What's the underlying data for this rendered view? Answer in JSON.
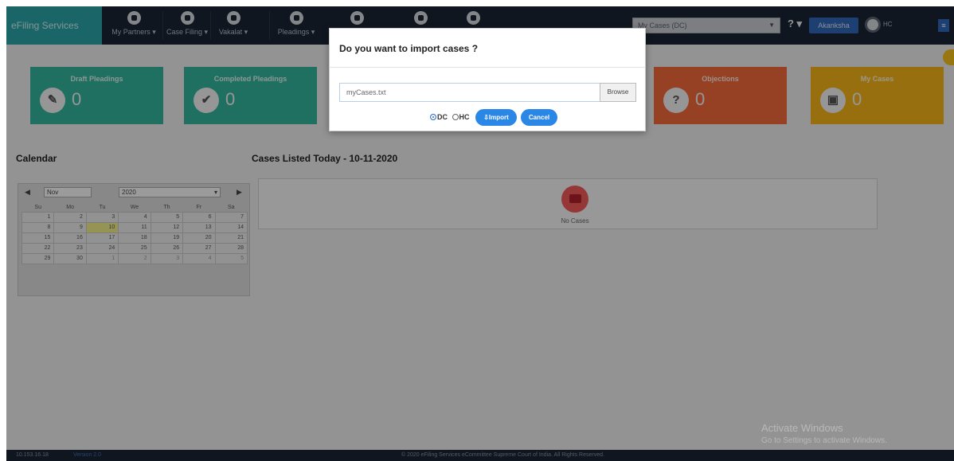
{
  "navbar": {
    "brand": "eFiling Services",
    "items": [
      {
        "label": "My Partners ▾"
      },
      {
        "label": "Case Filing ▾"
      },
      {
        "label": "Vakalat ▾"
      },
      {
        "label": "Pleadings ▾"
      },
      {
        "label": ""
      },
      {
        "label": ""
      },
      {
        "label": ""
      }
    ],
    "select_value": "My Cases (DC)",
    "help": "? ▾",
    "user_label": "Akanksha",
    "avatar_label": "HC",
    "right_btn": "≡"
  },
  "cards": {
    "draft": {
      "title": "Draft Pleadings",
      "count": "0",
      "icon": "edit-icon"
    },
    "completed": {
      "title": "Completed Pleadings",
      "count": "0",
      "icon": "check-icon"
    },
    "objections": {
      "title": "Objections",
      "count": "0",
      "icon": "question-icon"
    },
    "my_cases": {
      "title": "My Cases",
      "count": "0",
      "icon": "briefcase-icon"
    }
  },
  "calendar": {
    "title": "Calendar",
    "prev": "◀",
    "next": "▶",
    "month": "Nov",
    "year": "2020",
    "weekdays": [
      "Su",
      "Mo",
      "Tu",
      "We",
      "Th",
      "Fr",
      "Sa"
    ],
    "weeks": [
      [
        "1",
        "2",
        "3",
        "4",
        "5",
        "6",
        "7"
      ],
      [
        "8",
        "9",
        "10",
        "11",
        "12",
        "13",
        "14"
      ],
      [
        "15",
        "16",
        "17",
        "18",
        "19",
        "20",
        "21"
      ],
      [
        "22",
        "23",
        "24",
        "25",
        "26",
        "27",
        "28"
      ],
      [
        "29",
        "30",
        "1",
        "2",
        "3",
        "4",
        "5"
      ]
    ],
    "today": "10"
  },
  "cases_listed": {
    "title": "Cases Listed Today - 10-11-2020",
    "empty_label": "No Cases"
  },
  "modal": {
    "title": "Do you want to import cases ?",
    "file_value": "myCases.txt",
    "browse_label": "Browse",
    "radio_dc": "DC",
    "radio_hc": "HC",
    "import_label": "Import",
    "cancel_label": "Cancel"
  },
  "footer": {
    "ip": "10.153.16.18",
    "version": "Version 2.0",
    "copyright": "© 2020 eFiling Services eCommittee Supreme Court of India. All Rights Reserved."
  },
  "watermark": {
    "line1": "Activate Windows",
    "line2": "Go to Settings to activate Windows."
  },
  "colors": {
    "navbar": "#1b2433",
    "brand": "#2aa3a8",
    "card_green": "#34b59d",
    "card_orange": "#f46a3a",
    "card_yellow": "#f5b419",
    "accent_blue": "#2a87e6"
  }
}
